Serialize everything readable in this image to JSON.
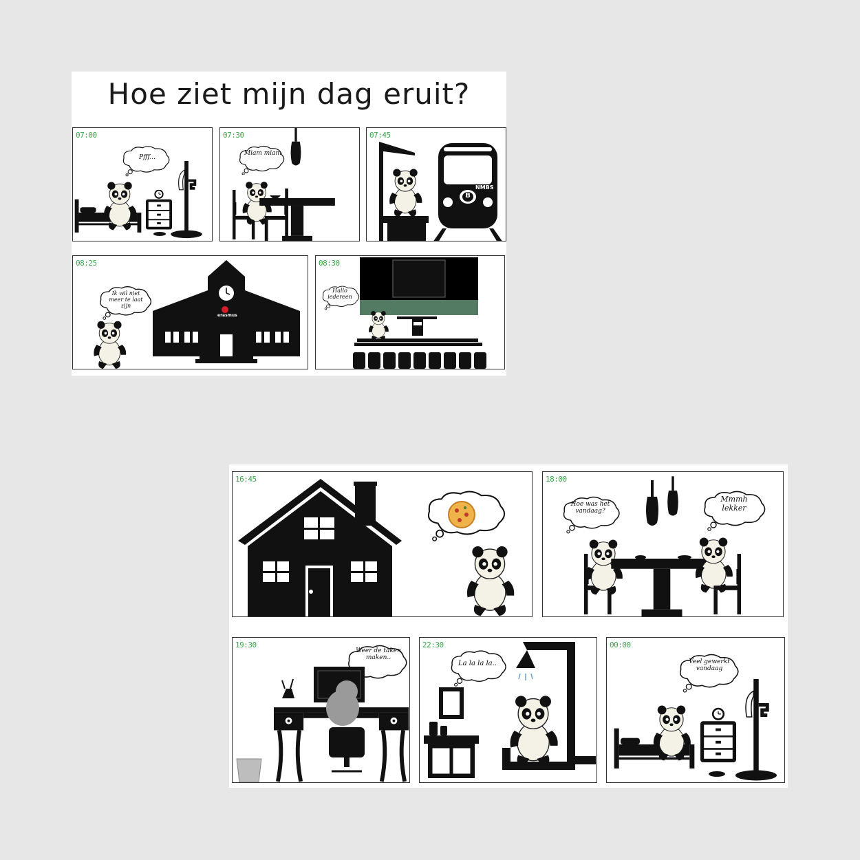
{
  "page": {
    "title": "Hoe ziet mijn dag eruit?"
  },
  "panels": [
    {
      "time": "07:00",
      "bubble": "Pfff..."
    },
    {
      "time": "07:30",
      "bubble": "Miam miam"
    },
    {
      "time": "07:45",
      "sign": "NMBS",
      "logo": "B"
    },
    {
      "time": "08:25",
      "bubble": "Ik wil niet meer te laat zijn",
      "sign": "erasmus"
    },
    {
      "time": "08:30",
      "bubble": "Hallo iedereen"
    },
    {
      "time": "16:45"
    },
    {
      "time": "18:00",
      "bubble_left": "Hoe was het vandaag?",
      "bubble_right": "Mmmh lekker"
    },
    {
      "time": "19:30",
      "bubble": "Weer de taken maken.."
    },
    {
      "time": "22:30",
      "bubble": "La la la la.."
    },
    {
      "time": "00:00",
      "bubble": "Veel gewerkt vandaag"
    }
  ]
}
